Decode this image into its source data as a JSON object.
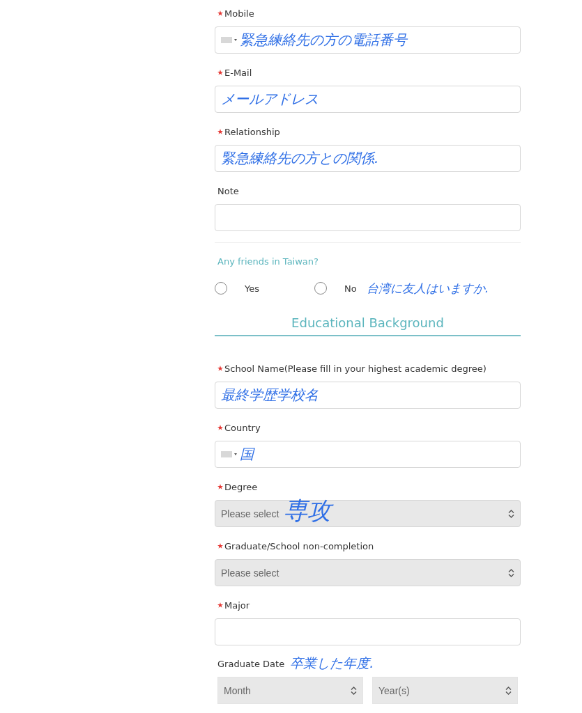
{
  "contact_fields": [
    {
      "kind": "phone",
      "label": "Mobile",
      "required": true,
      "annotation": "緊急練絡先の方の電話番号"
    },
    {
      "kind": "input",
      "label": "E-Mail",
      "required": true,
      "annotation": "メールアドレス"
    },
    {
      "kind": "input",
      "label": "Relationship",
      "required": true,
      "annotation": "緊急練絡先の方との関係."
    },
    {
      "kind": "input",
      "label": "Note",
      "required": false
    }
  ],
  "friends": {
    "question": "Any friends in Taiwan?",
    "options": [
      {
        "label": "Yes",
        "selected": false
      },
      {
        "label": "No",
        "selected": false
      }
    ],
    "annotation": "台湾に友人はいますか."
  },
  "section_title": "Educational Background",
  "education_fields": [
    {
      "kind": "input",
      "label": "School Name(Please fill in your highest academic degree)",
      "required": true,
      "annotation": "最終学歴学校名"
    },
    {
      "kind": "phone",
      "label": "Country",
      "required": true,
      "annotation": "国"
    },
    {
      "kind": "select",
      "label": "Degree",
      "required": true,
      "placeholder": "Please select",
      "annotation": "専攻"
    },
    {
      "kind": "select",
      "label": "Graduate/School non-completion",
      "required": true,
      "placeholder": "Please select"
    },
    {
      "kind": "input",
      "label": "Major",
      "required": true
    }
  ],
  "graduate_date": {
    "label": "Graduate Date",
    "annotation": "卒業した年度.",
    "selects": [
      {
        "placeholder": "Month"
      },
      {
        "placeholder": "Year(s)"
      }
    ]
  }
}
